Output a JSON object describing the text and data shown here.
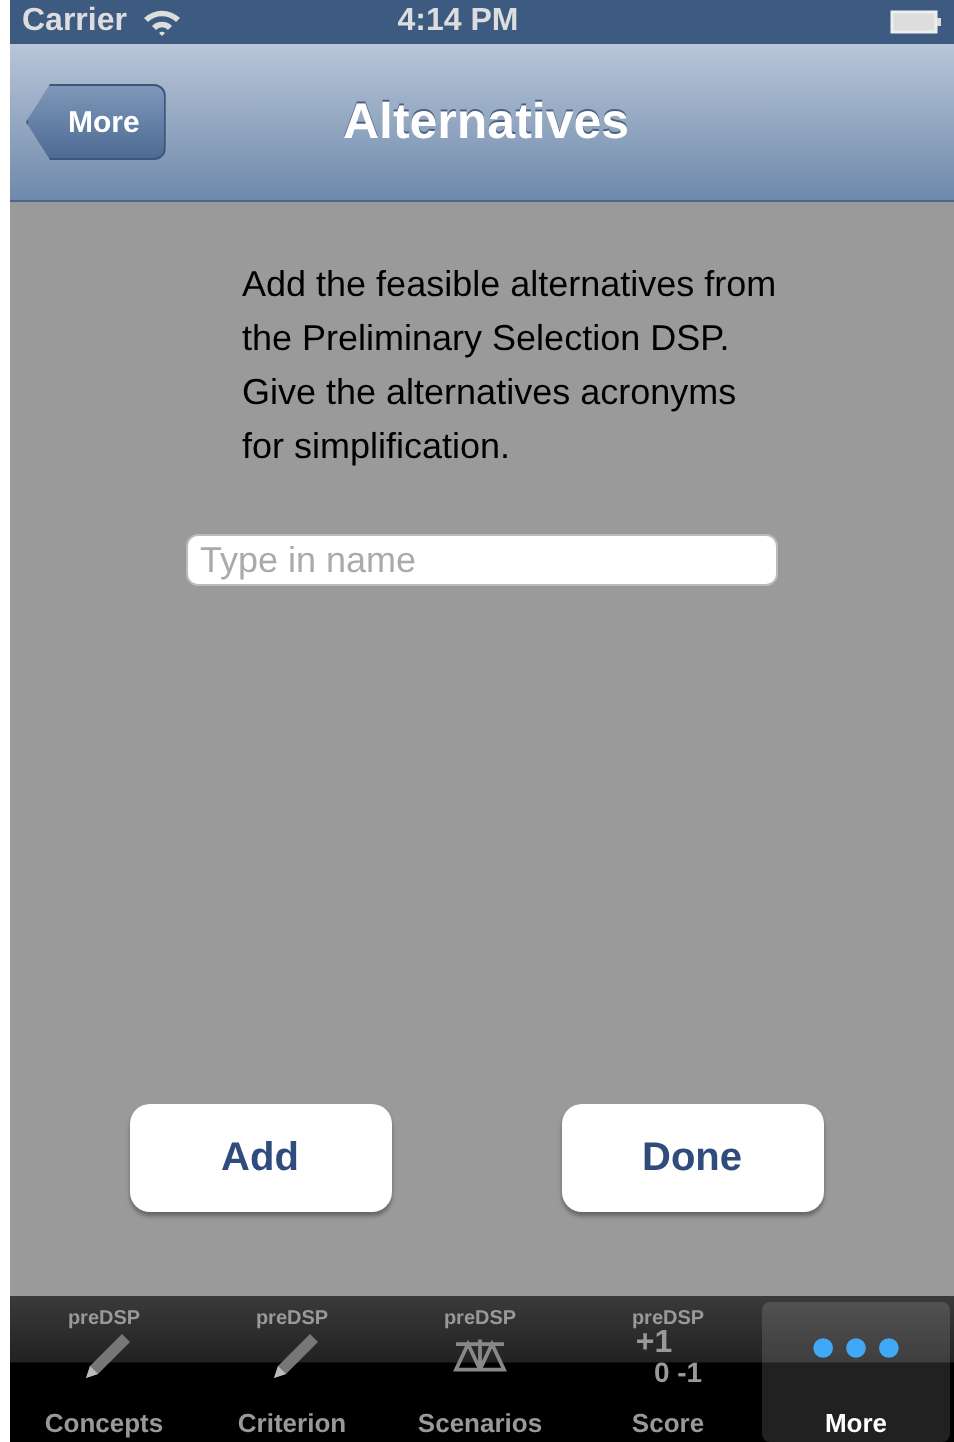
{
  "status_bar": {
    "carrier": "Carrier",
    "time": "4:14 PM"
  },
  "nav_bar": {
    "back": "More",
    "title": "Alternatives"
  },
  "instructions": "Add the feasible alternatives from the Preliminary Selection DSP. Give the alternatives acronyms for simplification.",
  "name_field": {
    "placeholder": "Type in name"
  },
  "buttons": [
    "Add",
    "Done"
  ],
  "tabs": [
    {
      "label": "Concepts",
      "kind": "pencil",
      "caption": "preDSP",
      "selected": false
    },
    {
      "label": "Criterion",
      "kind": "pencil",
      "caption": "preDSP",
      "selected": false
    },
    {
      "label": "Scenarios",
      "kind": "scale",
      "caption": "preDSP",
      "selected": false
    },
    {
      "label": "Score",
      "kind": "score",
      "caption": "preDSP",
      "score_top": "+1",
      "score_bottom": "0 -1",
      "selected": false
    },
    {
      "label": "More",
      "kind": "dots",
      "selected": true
    }
  ]
}
